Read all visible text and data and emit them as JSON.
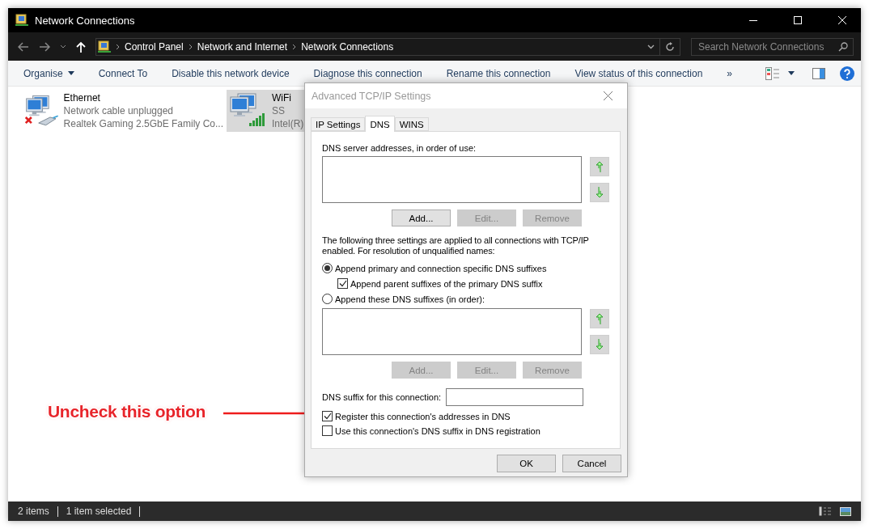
{
  "window": {
    "title": "Network Connections"
  },
  "address_bar": {
    "breadcrumbs": [
      "Control Panel",
      "Network and Internet",
      "Network Connections"
    ]
  },
  "search": {
    "placeholder": "Search Network Connections"
  },
  "toolbar": {
    "items": [
      {
        "label": "Organise",
        "dropdown": true
      },
      {
        "label": "Connect To",
        "dropdown": false
      },
      {
        "label": "Disable this network device",
        "dropdown": false
      },
      {
        "label": "Diagnose this connection",
        "dropdown": false
      },
      {
        "label": "Rename this connection",
        "dropdown": false
      },
      {
        "label": "View status of this connection",
        "dropdown": false
      }
    ],
    "more": "»"
  },
  "connections": [
    {
      "kind": "ethernet",
      "name": "Ethernet",
      "status": "Network cable unplugged",
      "device": "Realtek Gaming 2.5GbE Family Co...",
      "selected": false
    },
    {
      "kind": "wifi",
      "name": "WiFi",
      "status": "SS",
      "device": "Intel(R)",
      "selected": true
    }
  ],
  "dialog": {
    "title": "Advanced TCP/IP Settings",
    "tabs": [
      {
        "label": "IP Settings",
        "selected": false
      },
      {
        "label": "DNS",
        "selected": true
      },
      {
        "label": "WINS",
        "selected": false
      }
    ],
    "server_label": "DNS server addresses, in order of use:",
    "server_buttons": [
      {
        "label": "Add...",
        "disabled": false
      },
      {
        "label": "Edit...",
        "disabled": true
      },
      {
        "label": "Remove",
        "disabled": true
      }
    ],
    "description": "The following three settings are applied to all connections with TCP/IP enabled. For resolution of unqualified names:",
    "append_primary": {
      "label": "Append primary and connection specific DNS suffixes",
      "selected": true
    },
    "append_parent": {
      "label": "Append parent suffixes of the primary DNS suffix",
      "checked": true
    },
    "append_these": {
      "label": "Append these DNS suffixes (in order):",
      "selected": false
    },
    "suffix_buttons": [
      {
        "label": "Add...",
        "disabled": true
      },
      {
        "label": "Edit...",
        "disabled": true
      },
      {
        "label": "Remove",
        "disabled": true
      }
    ],
    "suffix_field": {
      "label": "DNS suffix for this connection:"
    },
    "options": [
      {
        "label": "Register this connection's addresses in DNS",
        "checked": true
      },
      {
        "label": "Use this connection's DNS suffix in DNS registration",
        "checked": false
      }
    ],
    "buttons": [
      "OK",
      "Cancel"
    ]
  },
  "annotation": {
    "text": "Uncheck this option"
  },
  "status_bar": {
    "items": [
      "2 items",
      "1 item selected"
    ]
  }
}
